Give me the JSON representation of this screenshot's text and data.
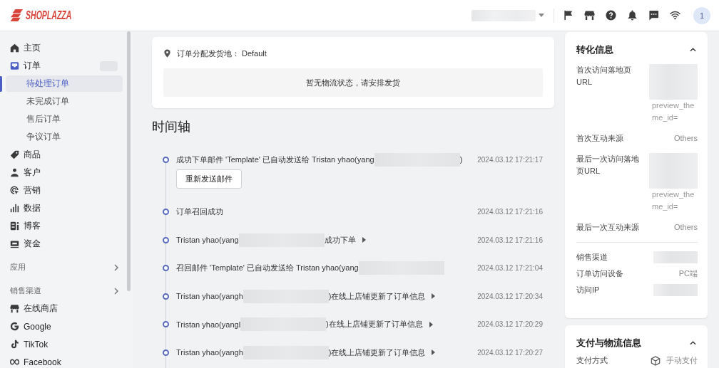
{
  "topbar": {
    "logo": "SHOPLAZZA",
    "store_selector": {
      "redacted": true
    },
    "avatar": "1"
  },
  "sidebar": {
    "items": [
      {
        "label": "主页",
        "selected": false,
        "badge_redacted": false
      },
      {
        "label": "订单",
        "selected": false,
        "badge_redacted": true,
        "children": [
          {
            "label": "待处理订单",
            "selected": true
          },
          {
            "label": "未完成订单",
            "selected": false
          },
          {
            "label": "售后订单",
            "selected": false
          },
          {
            "label": "争议订单",
            "selected": false
          }
        ]
      },
      {
        "label": "商品",
        "selected": false,
        "badge_redacted": false
      },
      {
        "label": "客户",
        "selected": false,
        "badge_redacted": false
      },
      {
        "label": "营销",
        "selected": false,
        "badge_redacted": false
      },
      {
        "label": "数据",
        "selected": false,
        "badge_redacted": false
      },
      {
        "label": "博客",
        "selected": false,
        "badge_redacted": false
      },
      {
        "label": "资金",
        "selected": false,
        "badge_redacted": false
      }
    ],
    "sections": [
      {
        "title": "应用"
      },
      {
        "title": "销售渠道",
        "items": [
          {
            "label": "在线商店",
            "selected": false
          },
          {
            "label": "Google",
            "selected": false
          },
          {
            "label": "TikTok",
            "selected": false
          },
          {
            "label": "Facebook",
            "selected": false
          }
        ]
      }
    ]
  },
  "fulfillment": {
    "location_label": "订单分配发货地：",
    "location_value": "Default",
    "empty_message": "暂无物流状态，请安排发货"
  },
  "timeline": {
    "title": "时间轴",
    "events": [
      {
        "text": "成功下单邮件 'Template' 已自动发送给 Tristan yhao(yang",
        "redacted": true,
        "text_after": ")",
        "expandable": false,
        "time": "2024.03.12 17:21:17",
        "button": "重新发送邮件"
      },
      {
        "text": "订单召回成功",
        "redacted": false,
        "expandable": false,
        "time": "2024.03.12 17:21:16"
      },
      {
        "text": "Tristan yhao(yang",
        "redacted": true,
        "text_after": "成功下单",
        "expandable": true,
        "time": "2024.03.12 17:21:16"
      },
      {
        "text": "召回邮件 'Template' 已自动发送给 Tristan yhao(yang",
        "redacted": true,
        "expandable": false,
        "time": "2024.03.12 17:21:04"
      },
      {
        "text": "Tristan yhao(yangh",
        "redacted": true,
        "text_after": ")在线上店铺更新了订单信息",
        "expandable": true,
        "time": "2024.03.12 17:20:34"
      },
      {
        "text": "Tristan yhao(yangl",
        "redacted": true,
        "text_after": ")在线上店铺更新了订单信息",
        "expandable": true,
        "time": "2024.03.12 17:20:29"
      },
      {
        "text": "Tristan yhao(yangh",
        "redacted": true,
        "text_after": ")在线上店铺更新了订单信息",
        "expandable": true,
        "time": "2024.03.12 17:20:27"
      }
    ]
  },
  "right_panel": {
    "cards": [
      {
        "title": "转化信息",
        "expanded": true,
        "groups": [
          {
            "rows": [
              {
                "label": "首次访问落地页URL",
                "kind": "url",
                "value": "preview_theme_id="
              },
              {
                "label": "首次互动来源",
                "kind": "text",
                "value": "Others"
              },
              {
                "label": "最后一次访问落地页URL",
                "kind": "url",
                "value": "preview_theme_id="
              },
              {
                "label": "最后一次互动来源",
                "kind": "text",
                "value": "Others"
              }
            ]
          },
          {
            "rows": [
              {
                "label": "销售渠道",
                "kind": "redacted"
              },
              {
                "label": "订单访问设备",
                "kind": "text",
                "value": "PC端"
              },
              {
                "label": "访问IP",
                "kind": "redacted"
              }
            ]
          }
        ]
      },
      {
        "title": "支付与物流信息",
        "expanded": true,
        "groups": [
          {
            "rows": [
              {
                "label": "支付方式",
                "kind": "icon_text",
                "value": "手动支付"
              }
            ]
          }
        ]
      }
    ]
  }
}
